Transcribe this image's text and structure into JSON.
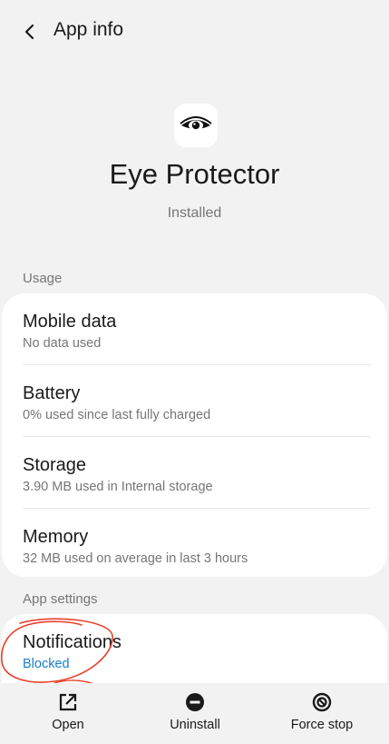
{
  "header": {
    "back_icon": "chevron-left-icon",
    "title": "App info"
  },
  "app": {
    "icon": "eye-icon",
    "name": "Eye Protector",
    "status": "Installed"
  },
  "usage": {
    "label": "Usage",
    "items": [
      {
        "title": "Mobile data",
        "subtitle": "No data used"
      },
      {
        "title": "Battery",
        "subtitle": "0% used since last fully charged"
      },
      {
        "title": "Storage",
        "subtitle": "3.90 MB used in Internal storage"
      },
      {
        "title": "Memory",
        "subtitle": "32 MB used on average in last 3 hours"
      }
    ]
  },
  "app_settings": {
    "label": "App settings",
    "notifications": {
      "title": "Notifications",
      "subtitle": "Blocked"
    }
  },
  "bottom_actions": [
    {
      "icon": "open-external-icon",
      "label": "Open"
    },
    {
      "icon": "minus-circle-icon",
      "label": "Uninstall"
    },
    {
      "icon": "stop-circle-icon",
      "label": "Force stop"
    }
  ],
  "colors": {
    "background": "#f2f2f2",
    "card": "#ffffff",
    "link_blue": "#1a7fc4",
    "annotation_red": "#e8412c"
  }
}
